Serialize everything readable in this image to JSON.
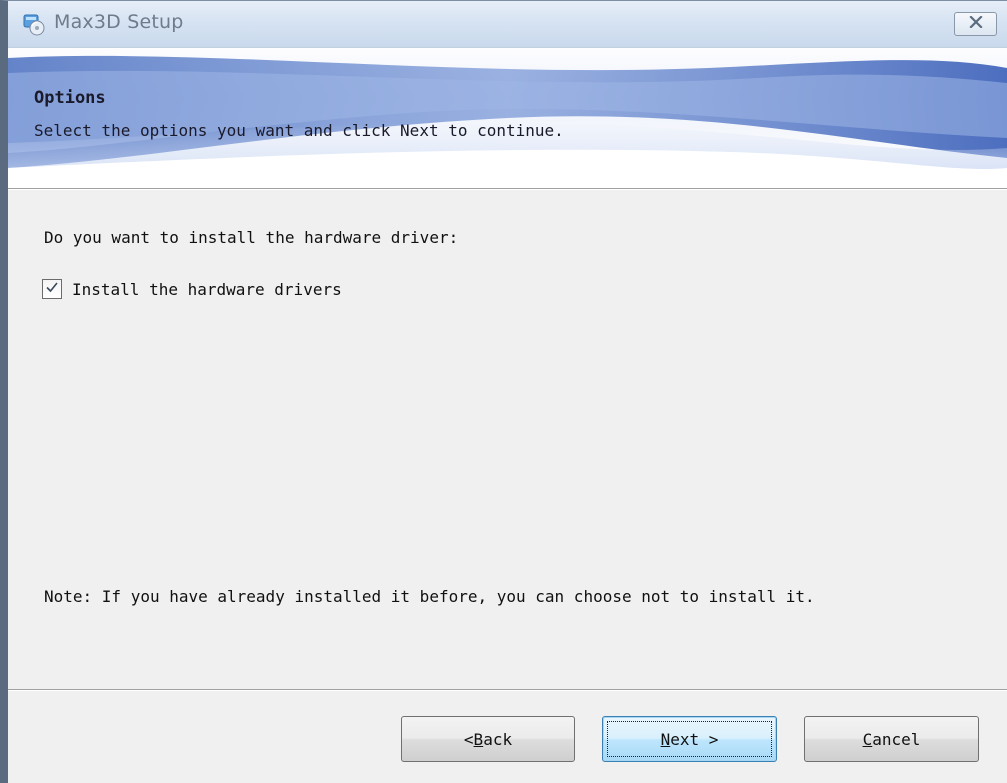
{
  "window": {
    "title": "Max3D Setup"
  },
  "banner": {
    "title": "Options",
    "subtitle": "Select the options you want and click Next to continue."
  },
  "content": {
    "question": "Do you want to install the hardware driver:",
    "checkbox": {
      "label": "Install the hardware drivers",
      "checked": true
    },
    "note": "Note: If you have already installed it before, you can choose not to install it."
  },
  "buttons": {
    "back": {
      "prefix": "< ",
      "mnemonic": "B",
      "rest": "ack"
    },
    "next": {
      "mnemonic": "N",
      "rest": "ext >"
    },
    "cancel": {
      "mnemonic": "C",
      "rest": "ancel"
    }
  },
  "icons": {
    "app": "installer-disc-icon",
    "close": "close-icon",
    "check": "checkmark-icon"
  },
  "colors": {
    "banner_accent": "#4f79c8",
    "title_text": "#6f7b8a",
    "default_button_border": "#3c7fb1"
  }
}
